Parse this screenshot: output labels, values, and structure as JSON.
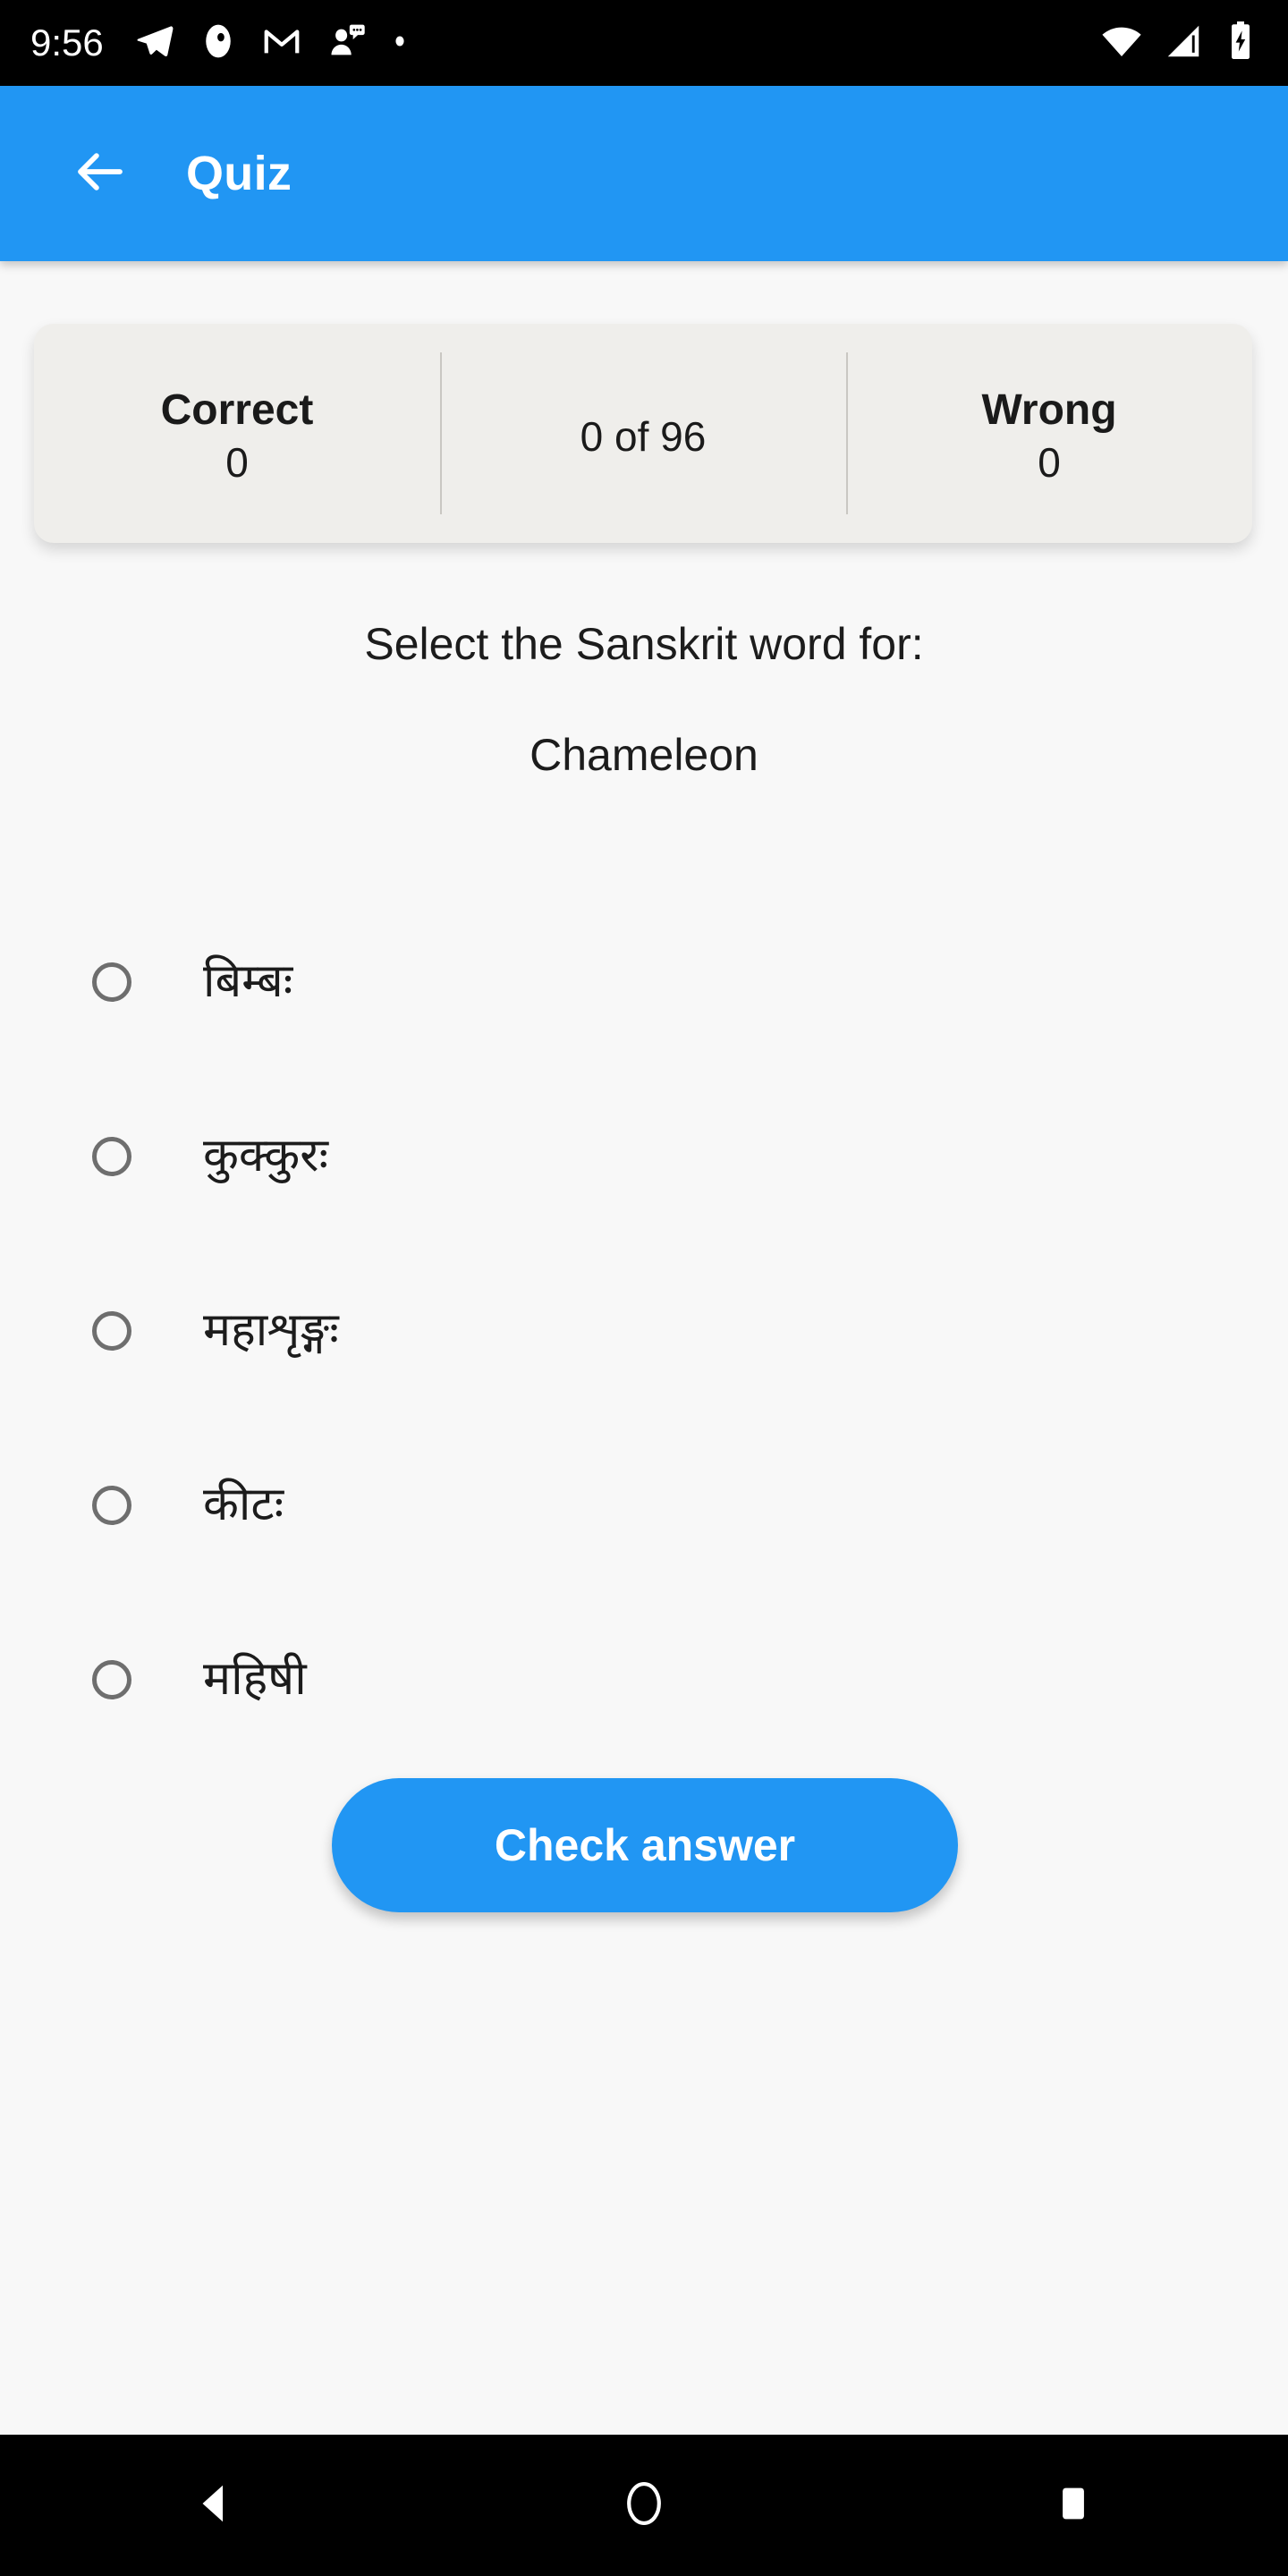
{
  "status_bar": {
    "time": "9:56",
    "left_icons": [
      "telegram-icon",
      "circle-app-icon",
      "gmail-icon",
      "person-chat-icon",
      "dot-icon"
    ],
    "right_icons": [
      "wifi-icon",
      "cellular-signal-icon",
      "battery-charging-icon"
    ]
  },
  "app_bar": {
    "back_icon": "back-arrow-icon",
    "title": "Quiz"
  },
  "score_card": {
    "correct_label": "Correct",
    "correct_value": "0",
    "progress": "0 of 96",
    "wrong_label": "Wrong",
    "wrong_value": "0"
  },
  "question": {
    "prompt": "Select the Sanskrit word for:",
    "word": "Chameleon"
  },
  "options": [
    {
      "label": "बिम्बः",
      "selected": false
    },
    {
      "label": "कुक्कुरः",
      "selected": false
    },
    {
      "label": "महाशृङ्गः",
      "selected": false
    },
    {
      "label": "कीटः",
      "selected": false
    },
    {
      "label": "महिषी",
      "selected": false
    }
  ],
  "actions": {
    "check_answer": "Check answer"
  },
  "nav_bar": {
    "back": "nav-back-icon",
    "home": "nav-home-icon",
    "recents": "nav-recents-icon"
  },
  "colors": {
    "accent": "#2196F3",
    "page_background": "#F8F8F8",
    "card_background": "#EFEEEB",
    "text_primary": "#1C1C1C",
    "radio_outline": "#6E6E6E"
  }
}
